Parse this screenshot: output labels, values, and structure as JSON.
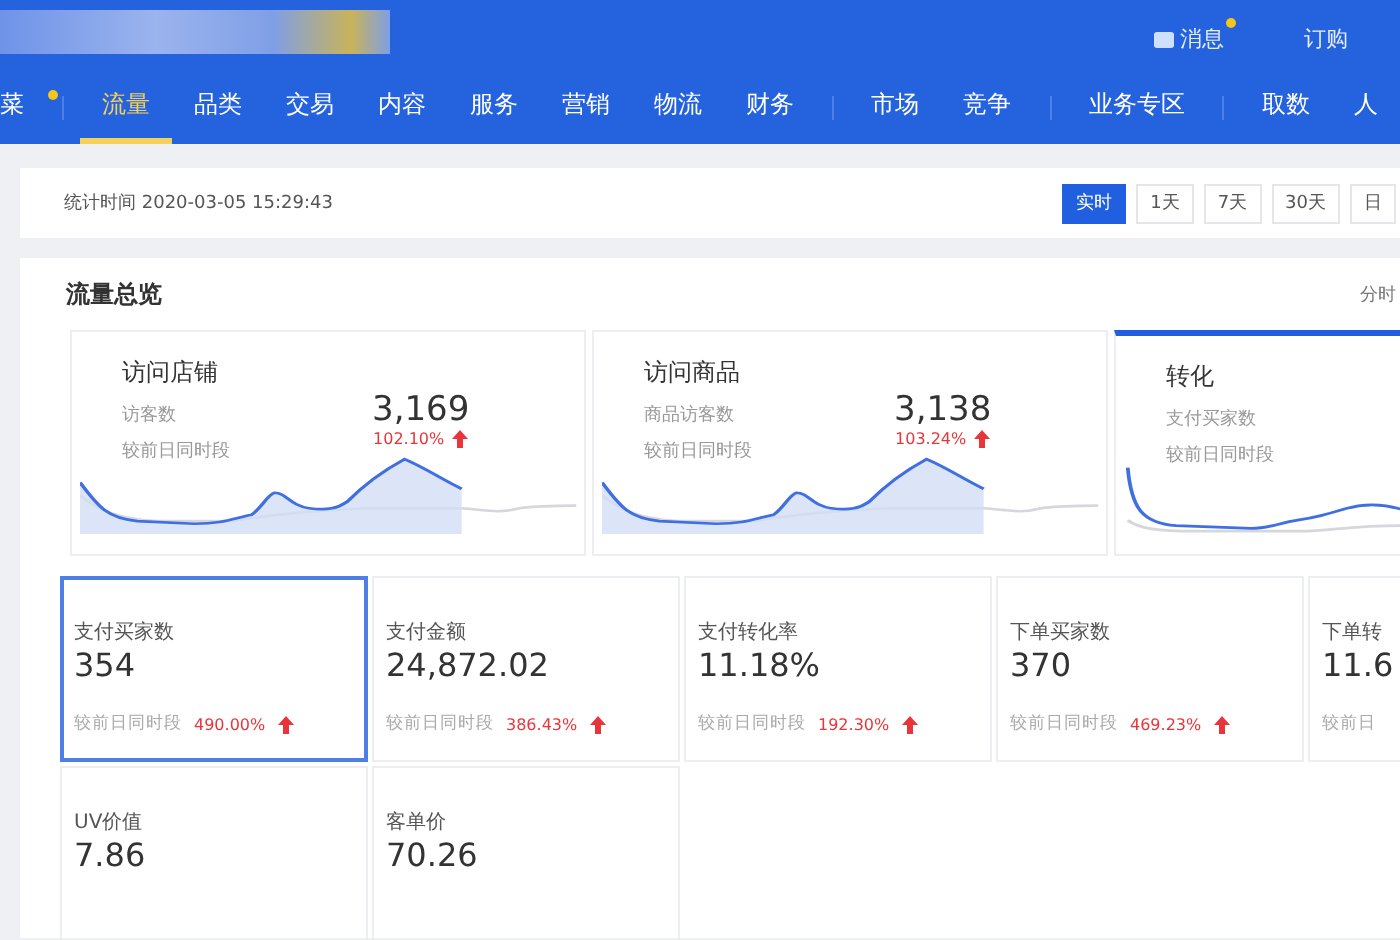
{
  "header": {
    "links": [
      {
        "label": "消息",
        "dot": true
      },
      {
        "label": "订购",
        "dot": false
      }
    ]
  },
  "nav": {
    "groups": [
      [
        {
          "label": "菜",
          "selected": false,
          "dot": true
        }
      ],
      [
        {
          "label": "流量",
          "selected": true,
          "dot": false
        },
        {
          "label": "品类",
          "selected": false,
          "dot": false
        },
        {
          "label": "交易",
          "selected": false,
          "dot": false
        },
        {
          "label": "内容",
          "selected": false,
          "dot": false
        },
        {
          "label": "服务",
          "selected": false,
          "dot": false
        },
        {
          "label": "营销",
          "selected": false,
          "dot": false
        },
        {
          "label": "物流",
          "selected": false,
          "dot": false
        },
        {
          "label": "财务",
          "selected": false,
          "dot": false
        }
      ],
      [
        {
          "label": "市场",
          "selected": false,
          "dot": false
        },
        {
          "label": "竞争",
          "selected": false,
          "dot": false
        }
      ],
      [
        {
          "label": "业务专区",
          "selected": false,
          "dot": false
        }
      ],
      [
        {
          "label": "取数",
          "selected": false,
          "dot": false
        },
        {
          "label": "人",
          "selected": false,
          "dot": false
        }
      ]
    ]
  },
  "stat_time": "统计时间 2020-03-05 15:29:43",
  "periods": [
    {
      "label": "实时",
      "selected": true
    },
    {
      "label": "1天",
      "selected": false
    },
    {
      "label": "7天",
      "selected": false
    },
    {
      "label": "30天",
      "selected": false
    },
    {
      "label": "日",
      "selected": false
    }
  ],
  "overview": {
    "title": "流量总览",
    "link": "分时",
    "cards": [
      {
        "title": "访问店铺",
        "metric_label": "访客数",
        "value": "3,169",
        "compare_label": "较前日同时段",
        "change": "102.10%",
        "selected": false
      },
      {
        "title": "访问商品",
        "metric_label": "商品访客数",
        "value": "3,138",
        "compare_label": "较前日同时段",
        "change": "103.24%",
        "selected": false
      },
      {
        "title": "转化",
        "metric_label": "支付买家数",
        "compare_label": "较前日同时段",
        "selected": true
      }
    ]
  },
  "metrics": [
    {
      "label": "支付买家数",
      "value": "354",
      "compare_label": "较前日同时段",
      "change": "490.00%",
      "selected": true
    },
    {
      "label": "支付金额",
      "value": "24,872.02",
      "compare_label": "较前日同时段",
      "change": "386.43%",
      "selected": false
    },
    {
      "label": "支付转化率",
      "value": "11.18%",
      "compare_label": "较前日同时段",
      "change": "192.30%",
      "selected": false
    },
    {
      "label": "下单买家数",
      "value": "370",
      "compare_label": "较前日同时段",
      "change": "469.23%",
      "selected": false
    },
    {
      "label": "下单转",
      "value": "11.6",
      "compare_label": "较前日",
      "selected": false
    },
    {
      "label": "UV价值",
      "value": "7.86",
      "selected": false
    },
    {
      "label": "客单价",
      "value": "70.26",
      "selected": false
    }
  ]
}
